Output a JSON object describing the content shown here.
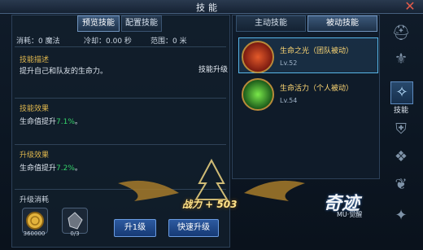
{
  "window": {
    "title": "技能",
    "close_icon": "close-icon"
  },
  "left_tabs": [
    {
      "label": "预览技能",
      "active": true
    },
    {
      "label": "配置技能",
      "active": false
    }
  ],
  "stats": {
    "cost_text": "消耗：0 魔法",
    "cooldown_text": "冷却：0.00 秒",
    "range_text": "范围：0 米"
  },
  "description": {
    "title": "技能描述",
    "text": "提升自己和队友的生命力。"
  },
  "upgrade_label": "技能升级",
  "effect": {
    "title": "技能效果",
    "prefix": "生命值提升",
    "value": "7.1%",
    "suffix": "。"
  },
  "upgrade_effect": {
    "title": "升级效果",
    "prefix": "生命值提升",
    "value": "7.2%",
    "suffix": "。"
  },
  "upgrade_cost": {
    "title": "升级消耗",
    "items": [
      {
        "icon": "gold-coin-icon",
        "amount": "360000"
      },
      {
        "icon": "stone-icon",
        "amount": "0/3"
      }
    ]
  },
  "buttons": {
    "upgrade_one": "升1级",
    "quick_upgrade": "快速升级"
  },
  "power_text": "战力 + 503",
  "right_tabs": [
    {
      "label": "主动技能",
      "active": false
    },
    {
      "label": "被动技能",
      "active": true
    }
  ],
  "skills": [
    {
      "name": "生命之光（团队被动）",
      "level": "Lv.52",
      "icon": "life-light-icon",
      "selected": true
    },
    {
      "name": "生命活力（个人被动）",
      "level": "Lv.54",
      "icon": "life-vitality-icon",
      "selected": false
    }
  ],
  "side_nav": {
    "active_label": "技能"
  },
  "logo": {
    "main": "奇迹",
    "sub": "MU·觉醒"
  }
}
